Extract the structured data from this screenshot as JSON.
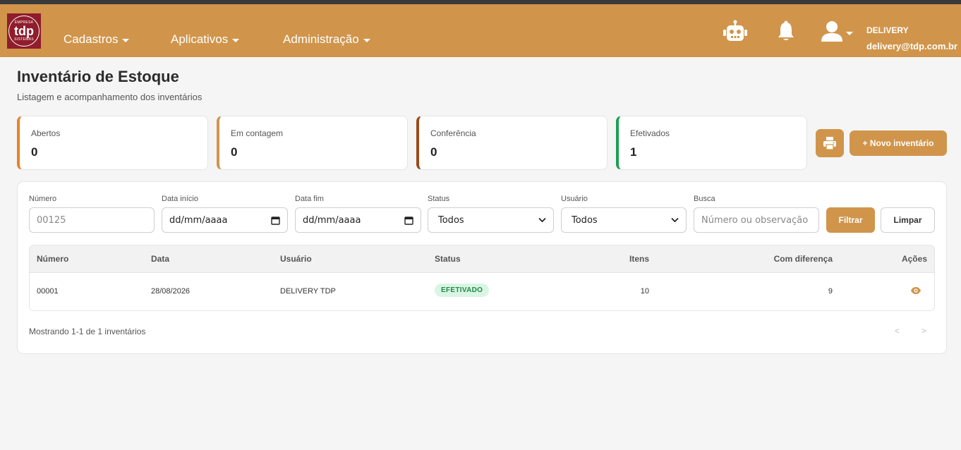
{
  "brand": {
    "logo_top": "EMPRESA",
    "logo_main": "tdp",
    "logo_bottom": "SISTEMAS"
  },
  "nav": {
    "menus": [
      "Cadastros",
      "Aplicativos",
      "Administração"
    ],
    "icons": [
      "robot-icon",
      "bell-icon",
      "user-icon"
    ]
  },
  "user": {
    "name": "DELIVERY",
    "email": "delivery@tdp.com.br"
  },
  "page": {
    "title": "Inventário de Estoque",
    "subtitle": "Listagem e acompanhamento dos inventários"
  },
  "cards": [
    {
      "label": "Abertos",
      "value": "0",
      "color": "#e8822b"
    },
    {
      "label": "Em contagem",
      "value": "0",
      "color": "#d0954b"
    },
    {
      "label": "Conferência",
      "value": "0",
      "color": "#9a4a16"
    },
    {
      "label": "Efetivados",
      "value": "1",
      "color": "#1e9e53"
    }
  ],
  "actions": {
    "new_label": "+ Novo inventário"
  },
  "filters": {
    "numero": {
      "label": "Número",
      "placeholder": "00125"
    },
    "data_inicio": {
      "label": "Data início",
      "value": "dd/mm/aaaa"
    },
    "data_fim": {
      "label": "Data fim",
      "value": "dd/mm/aaaa"
    },
    "status": {
      "label": "Status",
      "value": "Todos"
    },
    "usuario": {
      "label": "Usuário",
      "value": "Todos"
    },
    "busca": {
      "label": "Busca",
      "placeholder": "Número ou observação"
    },
    "filtrar_label": "Filtrar",
    "limpar_label": "Limpar"
  },
  "table": {
    "headers": {
      "numero": "Número",
      "data": "Data",
      "usuario": "Usuário",
      "status": "Status",
      "itens": "Itens",
      "diferenca": "Com diferença",
      "acoes": "Ações"
    },
    "rows": [
      {
        "numero": "00001",
        "data": "28/08/2026",
        "usuario": "DELIVERY TDP",
        "status": "EFETIVADO",
        "itens": "10",
        "diferenca": "9"
      }
    ]
  },
  "pagination": {
    "summary": "Mostrando 1-1 de 1 inventários",
    "prev": "<",
    "next": ">"
  },
  "colors": {
    "brand": "#d0954b",
    "logo_bg": "#8f1d2c",
    "success": "#1f8a47"
  }
}
